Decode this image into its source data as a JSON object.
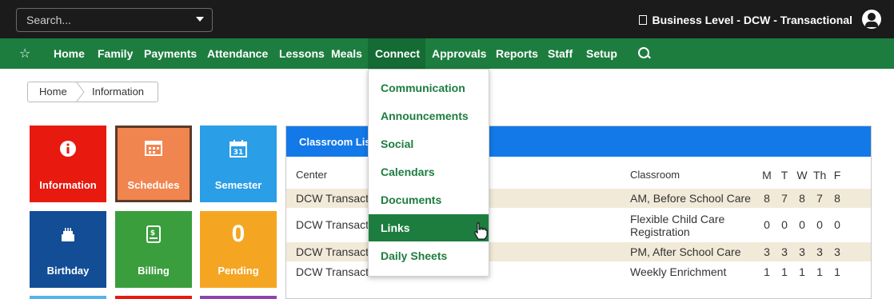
{
  "search": {
    "placeholder": "Search..."
  },
  "header": {
    "business_level": "Business Level - DCW - Transactional"
  },
  "nav": {
    "items": [
      "Home",
      "Family",
      "Payments",
      "Attendance",
      "Lessons",
      "Meals",
      "Connect",
      "Approvals",
      "Reports",
      "Staff",
      "Setup"
    ],
    "active": "Connect"
  },
  "breadcrumb": {
    "items": [
      "Home",
      "Information"
    ]
  },
  "tiles": [
    {
      "label": "Information",
      "icon": "info-icon",
      "color": "#e8190f"
    },
    {
      "label": "Schedules",
      "icon": "calendar-grid-icon",
      "color": "#f1854f"
    },
    {
      "label": "Semester",
      "icon": "calendar-31-icon",
      "color": "#2a9ee6"
    },
    {
      "label": "Birthday",
      "icon": "cake-icon",
      "color": "#124d96"
    },
    {
      "label": "Billing",
      "icon": "bill-icon",
      "color": "#3a9e3d"
    },
    {
      "label": "Pending",
      "value": "0",
      "color": "#f4a623"
    }
  ],
  "classroom_list": {
    "title": "Classroom List",
    "headers": {
      "center": "Center",
      "classroom": "Classroom",
      "days": [
        "M",
        "T",
        "W",
        "Th",
        "F"
      ]
    },
    "rows": [
      {
        "center": "DCW Transacti",
        "classroom": "AM, Before School Care",
        "days": [
          "8",
          "7",
          "8",
          "7",
          "8"
        ]
      },
      {
        "center": "DCW Transacti",
        "classroom": "Flexible Child Care Registration",
        "days": [
          "0",
          "0",
          "0",
          "0",
          "0"
        ]
      },
      {
        "center": "DCW Transacti",
        "classroom": "PM, After School Care",
        "days": [
          "3",
          "3",
          "3",
          "3",
          "3"
        ]
      },
      {
        "center": "DCW Transacti",
        "classroom": "Weekly Enrichment",
        "days": [
          "1",
          "1",
          "1",
          "1",
          "1"
        ]
      }
    ]
  },
  "connect_menu": {
    "items": [
      "Communication",
      "Announcements",
      "Social",
      "Calendars",
      "Documents",
      "Links",
      "Daily Sheets"
    ],
    "highlighted": "Links"
  },
  "colors": {
    "nav": "#1d7d3f",
    "topbar": "#1b1b1b",
    "panel_header": "#1479e8",
    "shade_row": "#f2ead8"
  }
}
